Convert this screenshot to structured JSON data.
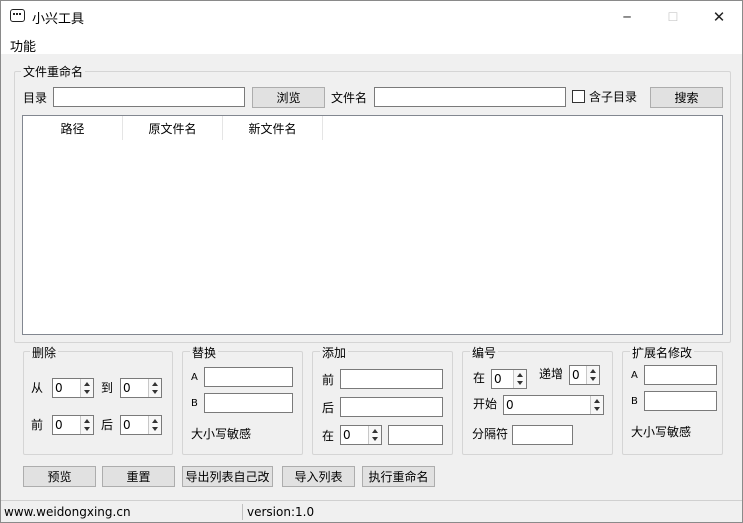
{
  "window": {
    "title": "小兴工具",
    "controls": {
      "minimize": "─",
      "maximize": "☐",
      "close": "✕"
    }
  },
  "menu": {
    "items": [
      {
        "label": "功能"
      }
    ]
  },
  "rename_group": {
    "title": "文件重命名",
    "dir_label": "目录",
    "dir_value": "",
    "browse_label": "浏览",
    "filename_label": "文件名",
    "filename_value": "",
    "subdir_label": "含子目录",
    "subdir_checked": false,
    "search_label": "搜索"
  },
  "file_list": {
    "columns": [
      "路径",
      "原文件名",
      "新文件名"
    ],
    "rows": []
  },
  "delete_group": {
    "title": "删除",
    "from_label": "从",
    "from_value": "0",
    "to_label": "到",
    "to_value": "0",
    "front_label": "前",
    "front_value": "0",
    "back_label": "后",
    "back_value": "0"
  },
  "replace_group": {
    "title": "替换",
    "a_label": "A",
    "a_value": "",
    "b_label": "B",
    "b_value": "",
    "case_label": "大小写敏感"
  },
  "add_group": {
    "title": "添加",
    "front_label": "前",
    "front_value": "",
    "back_label": "后",
    "back_value": "",
    "at_label": "在",
    "at_value": "0",
    "at_text": ""
  },
  "number_group": {
    "title": "编号",
    "at_label": "在",
    "at_value": "0",
    "step_label": "递增",
    "step_value": "0",
    "start_label": "开始",
    "start_value": "0",
    "separator_label": "分隔符",
    "separator_value": ""
  },
  "ext_group": {
    "title": "扩展名修改",
    "a_label": "A",
    "a_value": "",
    "b_label": "B",
    "b_value": "",
    "case_label": "大小写敏感"
  },
  "actions": {
    "preview": "预览",
    "reset": "重置",
    "export": "导出列表自己改",
    "import": "导入列表",
    "execute": "执行重命名"
  },
  "statusbar": {
    "website": "www.weidongxing.cn",
    "version": "version:1.0"
  }
}
